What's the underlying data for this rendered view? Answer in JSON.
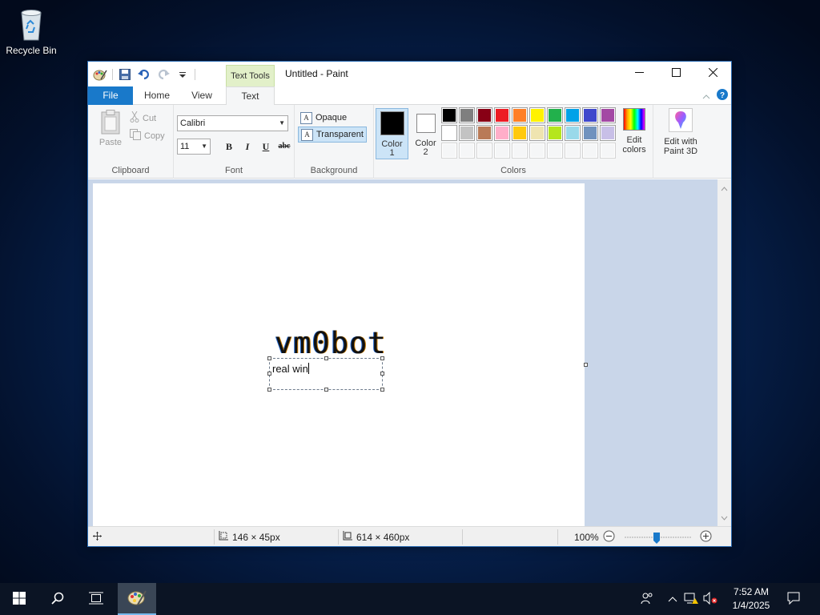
{
  "desktop": {
    "recycle_bin_label": "Recycle Bin"
  },
  "window": {
    "title": "Untitled - Paint",
    "context_tab_label": "Text Tools"
  },
  "tabs": {
    "file": "File",
    "home": "Home",
    "view": "View",
    "text": "Text"
  },
  "clipboard": {
    "paste": "Paste",
    "cut": "Cut",
    "copy": "Copy",
    "group_label": "Clipboard"
  },
  "font": {
    "family": "Calibri",
    "size": "11",
    "bold": "B",
    "italic": "I",
    "underline": "U",
    "strikethrough": "abc",
    "group_label": "Font"
  },
  "background": {
    "opaque": "Opaque",
    "transparent": "Transparent",
    "selected": "Transparent",
    "group_label": "Background"
  },
  "colors": {
    "color1_label": "Color 1",
    "color1_value": "#000000",
    "color2_label": "Color 2",
    "color2_value": "#ffffff",
    "edit_colors": "Edit colors",
    "group_label": "Colors",
    "palette": [
      "#000000",
      "#7f7f7f",
      "#880015",
      "#ed1c24",
      "#ff7f27",
      "#fff200",
      "#22b14c",
      "#00a2e8",
      "#3f48cc",
      "#a349a4",
      "#ffffff",
      "#c3c3c3",
      "#b97a57",
      "#ffaec9",
      "#ffc90e",
      "#efe4b0",
      "#b5e61d",
      "#99d9ea",
      "#7092be",
      "#c8bfe7",
      "",
      "",
      "",
      "",
      "",
      "",
      "",
      "",
      "",
      ""
    ]
  },
  "paint3d": {
    "label": "Edit with Paint 3D"
  },
  "canvas": {
    "big_text": "vm0bot",
    "typed_text": "real win"
  },
  "status": {
    "selection_size": "146 × 45px",
    "image_size": "614 × 460px",
    "zoom": "100%"
  },
  "taskbar": {
    "time": "7:52 AM",
    "date": "1/4/2025"
  }
}
